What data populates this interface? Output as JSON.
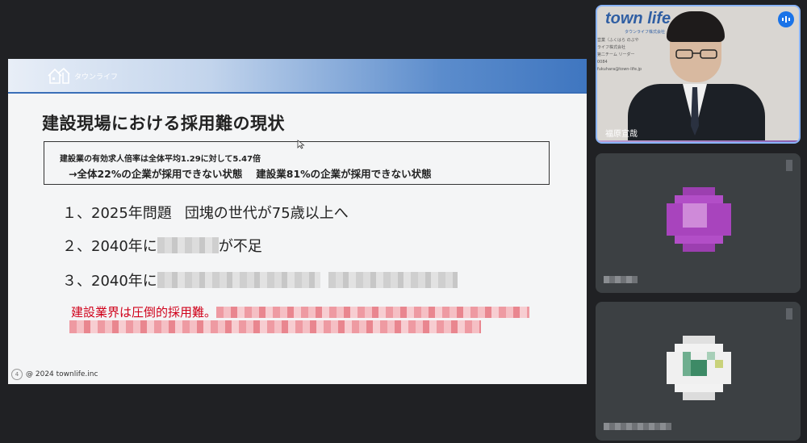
{
  "slide": {
    "logo_text": "タウンライフ",
    "title": "建設現場における採用難の現状",
    "stat_line1": "建設業の有効求人倍率は全体平均1.29に対して5.47倍",
    "stat_line2": "→全体22%の企業が採用できない状態　 建設業81%の企業が採用できない状態",
    "points": [
      {
        "prefix": "１、2025年問題",
        "text": "団塊の世代が75歳以上へ"
      },
      {
        "prefix": "２、2040年に",
        "suffix": "が不足"
      },
      {
        "prefix": "３、2040年に"
      }
    ],
    "highlight": "建設業界は圧倒的採用難。",
    "footer_copyright": "@ 2024 townlife.inc",
    "page_number": "4"
  },
  "video_tile": {
    "brand": "town life",
    "brand_sub": "タウンライフ株式会社",
    "card_lines": "営業（ふくはら のぶや\nライフ株式会社\n第二チーム リーダー\n0084\nfukuhara@town-life.jp",
    "name_label": "福原宣哉"
  },
  "colors": {
    "accent": "#3f76c0",
    "active_border": "#8ab4f8",
    "highlight_red": "#d0021b",
    "tile_bg": "#3c4043"
  }
}
